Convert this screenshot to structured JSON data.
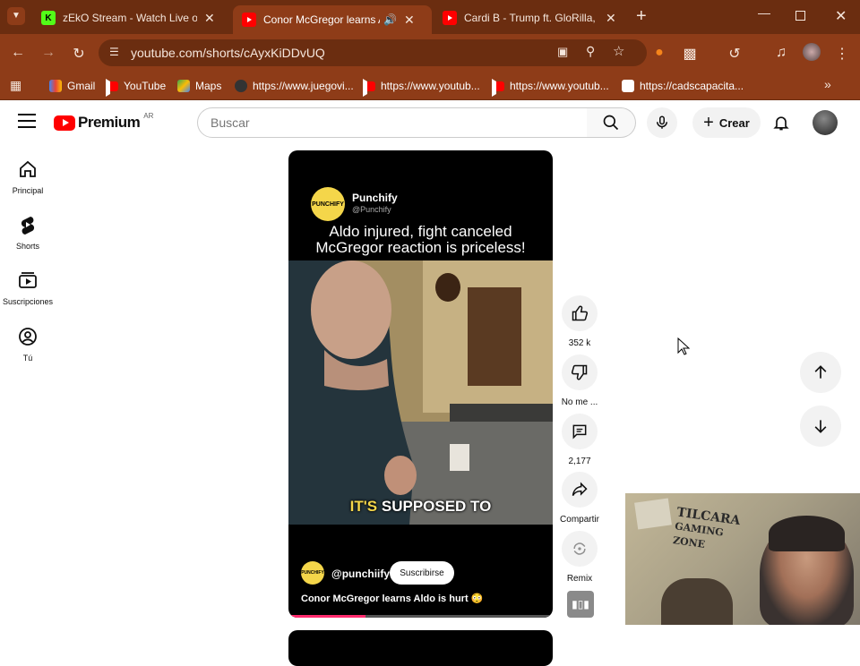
{
  "browser": {
    "tabs": [
      {
        "title": "zEkO Stream - Watch Live on Ki",
        "favicon": "kick-icon"
      },
      {
        "title": "Conor McGregor learns Aldo",
        "favicon": "youtube-icon",
        "active": true,
        "audio": true
      },
      {
        "title": "Cardi B - Trump ft. GloRilla, Lat",
        "favicon": "youtube-icon"
      }
    ],
    "url": "youtube.com/shorts/cAyxKiDDvUQ",
    "bookmarks": [
      {
        "label": "Gmail",
        "icon": "gmail-icon"
      },
      {
        "label": "YouTube",
        "icon": "youtube-icon"
      },
      {
        "label": "Maps",
        "icon": "maps-icon"
      },
      {
        "label": "https://www.juegovi...",
        "icon": "site-icon"
      },
      {
        "label": "https://www.youtub...",
        "icon": "youtube-icon"
      },
      {
        "label": "https://www.youtub...",
        "icon": "youtube-icon"
      },
      {
        "label": "https://cadscapacita...",
        "icon": "site-icon"
      }
    ]
  },
  "header": {
    "logo_text": "Premium",
    "region": "AR",
    "search_placeholder": "Buscar",
    "create_label": "Crear"
  },
  "sidebar": {
    "items": [
      {
        "label": "Principal",
        "icon": "home-icon"
      },
      {
        "label": "Shorts",
        "icon": "shorts-icon"
      },
      {
        "label": "Suscripciones",
        "icon": "subscriptions-icon"
      },
      {
        "label": "Tú",
        "icon": "you-icon"
      }
    ]
  },
  "short": {
    "channel_name": "Punchify",
    "channel_handle": "@Punchify",
    "logo_text": "PUNCHIFY",
    "headline_line1": "Aldo injured, fight canceled",
    "headline_line2": "McGregor reaction is priceless!",
    "caption_hl": "IT'S",
    "caption_rest": "SUPPOSED TO",
    "uploader_handle": "@punchiify",
    "subscribe_label": "Suscribirse",
    "title": "Conor McGregor learns Aldo is hurt 😳",
    "progress_fraction": 0.29
  },
  "actions": {
    "like_count": "352 k",
    "dislike_label": "No me ...",
    "comment_count": "2,177",
    "share_label": "Compartir",
    "remix_label": "Remix"
  },
  "webcam": {
    "sign_line1": "TILCARA",
    "sign_line2": "GAMING",
    "sign_line3": "ZONE"
  },
  "colors": {
    "browser_frame": "#6b2d10",
    "browser_toolbar": "#8e3c18",
    "youtube_red": "#ff0000",
    "brand_yellow": "#f4d64a",
    "progress": "#ff2b6e"
  }
}
